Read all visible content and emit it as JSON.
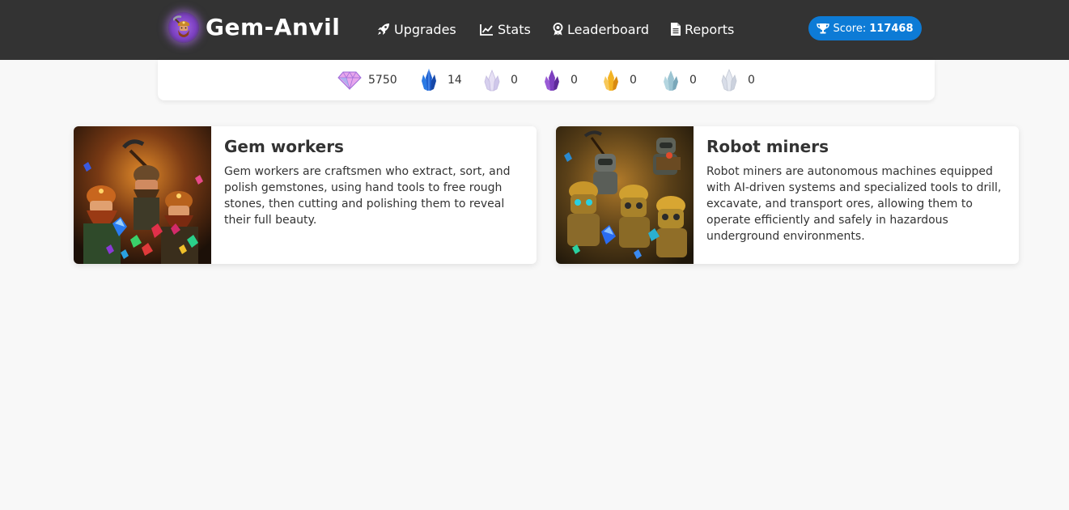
{
  "brand": {
    "name": "Gem-Anvil",
    "logo_icon": "dwarf-miner-icon"
  },
  "nav": {
    "items": [
      {
        "label": "Upgrades",
        "icon": "rocket-icon"
      },
      {
        "label": "Stats",
        "icon": "line-chart-icon"
      },
      {
        "label": "Leaderboard",
        "icon": "award-ribbon-icon"
      },
      {
        "label": "Reports",
        "icon": "document-icon"
      }
    ]
  },
  "score": {
    "label": "Score:",
    "value": "117468",
    "icon": "trophy-icon"
  },
  "resources": [
    {
      "icon": "pink-diamond-icon",
      "count": "5750",
      "color": "#d98be0"
    },
    {
      "icon": "blue-crystal-icon",
      "count": "14",
      "color": "#1f5fc8"
    },
    {
      "icon": "white-crystal-icon",
      "count": "0",
      "color": "#d8d2ee"
    },
    {
      "icon": "purple-crystal-icon",
      "count": "0",
      "color": "#7d3fbf"
    },
    {
      "icon": "amber-crystal-icon",
      "count": "0",
      "color": "#f0a51c"
    },
    {
      "icon": "teal-crystal-icon",
      "count": "0",
      "color": "#8fb8c8"
    },
    {
      "icon": "silver-crystal-icon",
      "count": "0",
      "color": "#d6dbe6"
    }
  ],
  "cards": [
    {
      "title": "Gem workers",
      "text": "Gem workers are craftsmen who extract, sort, and polish gemstones, using hand tools to free rough stones, then cutting and polishing them to reveal their full beauty.",
      "image": "dwarf-gem-workers-image"
    },
    {
      "title": "Robot miners",
      "text": "Robot miners are autonomous machines equipped with AI-driven systems and specialized tools to drill, excavate, and transport ores, allowing them to operate efficiently and safely in hazardous underground environments.",
      "image": "robot-miners-image"
    }
  ],
  "colors": {
    "navbar": "#333333",
    "score_badge": "#0d7bd6",
    "page_bg": "#f8f8f8"
  }
}
